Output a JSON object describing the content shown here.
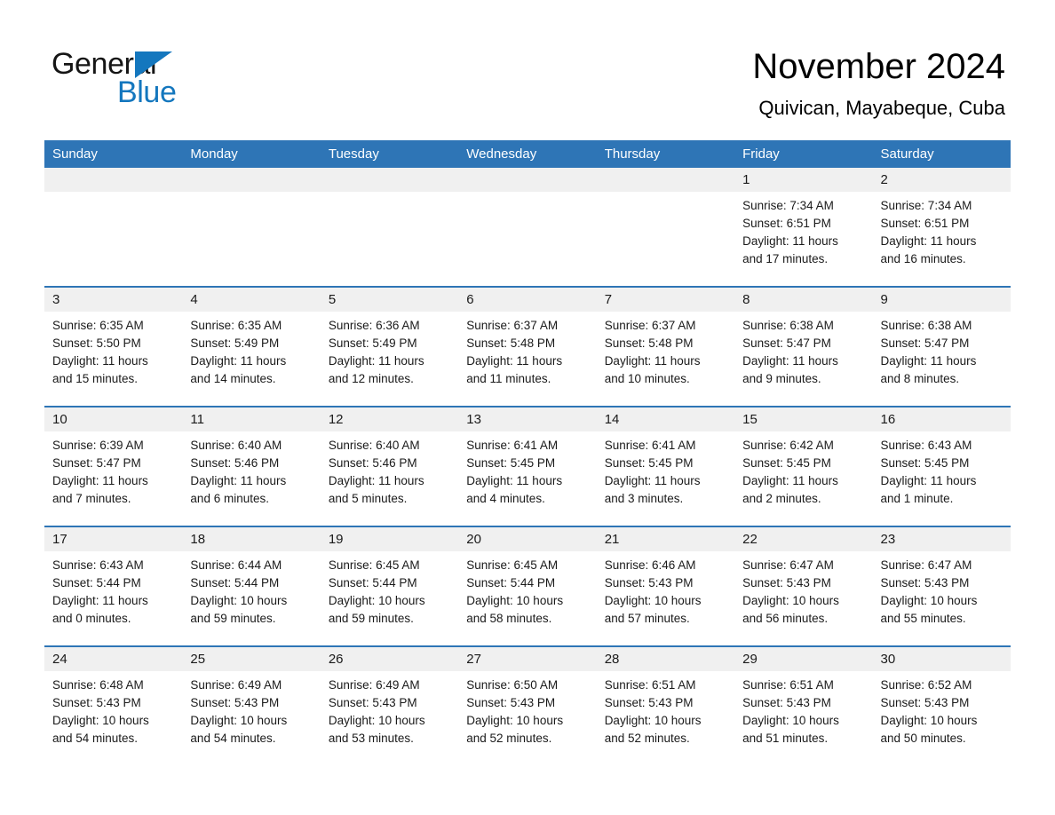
{
  "brand": {
    "line1": "General",
    "line2": "Blue",
    "triangle_color": "#1477be"
  },
  "header": {
    "month_title": "November 2024",
    "location": "Quivican, Mayabeque, Cuba"
  },
  "theme": {
    "header_blue": "#2e75b6",
    "daynum_band": "#f0f0f0",
    "text": "#1a1a1a"
  },
  "weekday_headers": [
    "Sunday",
    "Monday",
    "Tuesday",
    "Wednesday",
    "Thursday",
    "Friday",
    "Saturday"
  ],
  "weeks": [
    [
      {
        "day": "",
        "sunrise": "",
        "sunset": "",
        "daylight1": "",
        "daylight2": ""
      },
      {
        "day": "",
        "sunrise": "",
        "sunset": "",
        "daylight1": "",
        "daylight2": ""
      },
      {
        "day": "",
        "sunrise": "",
        "sunset": "",
        "daylight1": "",
        "daylight2": ""
      },
      {
        "day": "",
        "sunrise": "",
        "sunset": "",
        "daylight1": "",
        "daylight2": ""
      },
      {
        "day": "",
        "sunrise": "",
        "sunset": "",
        "daylight1": "",
        "daylight2": ""
      },
      {
        "day": "1",
        "sunrise": "Sunrise: 7:34 AM",
        "sunset": "Sunset: 6:51 PM",
        "daylight1": "Daylight: 11 hours",
        "daylight2": "and 17 minutes."
      },
      {
        "day": "2",
        "sunrise": "Sunrise: 7:34 AM",
        "sunset": "Sunset: 6:51 PM",
        "daylight1": "Daylight: 11 hours",
        "daylight2": "and 16 minutes."
      }
    ],
    [
      {
        "day": "3",
        "sunrise": "Sunrise: 6:35 AM",
        "sunset": "Sunset: 5:50 PM",
        "daylight1": "Daylight: 11 hours",
        "daylight2": "and 15 minutes."
      },
      {
        "day": "4",
        "sunrise": "Sunrise: 6:35 AM",
        "sunset": "Sunset: 5:49 PM",
        "daylight1": "Daylight: 11 hours",
        "daylight2": "and 14 minutes."
      },
      {
        "day": "5",
        "sunrise": "Sunrise: 6:36 AM",
        "sunset": "Sunset: 5:49 PM",
        "daylight1": "Daylight: 11 hours",
        "daylight2": "and 12 minutes."
      },
      {
        "day": "6",
        "sunrise": "Sunrise: 6:37 AM",
        "sunset": "Sunset: 5:48 PM",
        "daylight1": "Daylight: 11 hours",
        "daylight2": "and 11 minutes."
      },
      {
        "day": "7",
        "sunrise": "Sunrise: 6:37 AM",
        "sunset": "Sunset: 5:48 PM",
        "daylight1": "Daylight: 11 hours",
        "daylight2": "and 10 minutes."
      },
      {
        "day": "8",
        "sunrise": "Sunrise: 6:38 AM",
        "sunset": "Sunset: 5:47 PM",
        "daylight1": "Daylight: 11 hours",
        "daylight2": "and 9 minutes."
      },
      {
        "day": "9",
        "sunrise": "Sunrise: 6:38 AM",
        "sunset": "Sunset: 5:47 PM",
        "daylight1": "Daylight: 11 hours",
        "daylight2": "and 8 minutes."
      }
    ],
    [
      {
        "day": "10",
        "sunrise": "Sunrise: 6:39 AM",
        "sunset": "Sunset: 5:47 PM",
        "daylight1": "Daylight: 11 hours",
        "daylight2": "and 7 minutes."
      },
      {
        "day": "11",
        "sunrise": "Sunrise: 6:40 AM",
        "sunset": "Sunset: 5:46 PM",
        "daylight1": "Daylight: 11 hours",
        "daylight2": "and 6 minutes."
      },
      {
        "day": "12",
        "sunrise": "Sunrise: 6:40 AM",
        "sunset": "Sunset: 5:46 PM",
        "daylight1": "Daylight: 11 hours",
        "daylight2": "and 5 minutes."
      },
      {
        "day": "13",
        "sunrise": "Sunrise: 6:41 AM",
        "sunset": "Sunset: 5:45 PM",
        "daylight1": "Daylight: 11 hours",
        "daylight2": "and 4 minutes."
      },
      {
        "day": "14",
        "sunrise": "Sunrise: 6:41 AM",
        "sunset": "Sunset: 5:45 PM",
        "daylight1": "Daylight: 11 hours",
        "daylight2": "and 3 minutes."
      },
      {
        "day": "15",
        "sunrise": "Sunrise: 6:42 AM",
        "sunset": "Sunset: 5:45 PM",
        "daylight1": "Daylight: 11 hours",
        "daylight2": "and 2 minutes."
      },
      {
        "day": "16",
        "sunrise": "Sunrise: 6:43 AM",
        "sunset": "Sunset: 5:45 PM",
        "daylight1": "Daylight: 11 hours",
        "daylight2": "and 1 minute."
      }
    ],
    [
      {
        "day": "17",
        "sunrise": "Sunrise: 6:43 AM",
        "sunset": "Sunset: 5:44 PM",
        "daylight1": "Daylight: 11 hours",
        "daylight2": "and 0 minutes."
      },
      {
        "day": "18",
        "sunrise": "Sunrise: 6:44 AM",
        "sunset": "Sunset: 5:44 PM",
        "daylight1": "Daylight: 10 hours",
        "daylight2": "and 59 minutes."
      },
      {
        "day": "19",
        "sunrise": "Sunrise: 6:45 AM",
        "sunset": "Sunset: 5:44 PM",
        "daylight1": "Daylight: 10 hours",
        "daylight2": "and 59 minutes."
      },
      {
        "day": "20",
        "sunrise": "Sunrise: 6:45 AM",
        "sunset": "Sunset: 5:44 PM",
        "daylight1": "Daylight: 10 hours",
        "daylight2": "and 58 minutes."
      },
      {
        "day": "21",
        "sunrise": "Sunrise: 6:46 AM",
        "sunset": "Sunset: 5:43 PM",
        "daylight1": "Daylight: 10 hours",
        "daylight2": "and 57 minutes."
      },
      {
        "day": "22",
        "sunrise": "Sunrise: 6:47 AM",
        "sunset": "Sunset: 5:43 PM",
        "daylight1": "Daylight: 10 hours",
        "daylight2": "and 56 minutes."
      },
      {
        "day": "23",
        "sunrise": "Sunrise: 6:47 AM",
        "sunset": "Sunset: 5:43 PM",
        "daylight1": "Daylight: 10 hours",
        "daylight2": "and 55 minutes."
      }
    ],
    [
      {
        "day": "24",
        "sunrise": "Sunrise: 6:48 AM",
        "sunset": "Sunset: 5:43 PM",
        "daylight1": "Daylight: 10 hours",
        "daylight2": "and 54 minutes."
      },
      {
        "day": "25",
        "sunrise": "Sunrise: 6:49 AM",
        "sunset": "Sunset: 5:43 PM",
        "daylight1": "Daylight: 10 hours",
        "daylight2": "and 54 minutes."
      },
      {
        "day": "26",
        "sunrise": "Sunrise: 6:49 AM",
        "sunset": "Sunset: 5:43 PM",
        "daylight1": "Daylight: 10 hours",
        "daylight2": "and 53 minutes."
      },
      {
        "day": "27",
        "sunrise": "Sunrise: 6:50 AM",
        "sunset": "Sunset: 5:43 PM",
        "daylight1": "Daylight: 10 hours",
        "daylight2": "and 52 minutes."
      },
      {
        "day": "28",
        "sunrise": "Sunrise: 6:51 AM",
        "sunset": "Sunset: 5:43 PM",
        "daylight1": "Daylight: 10 hours",
        "daylight2": "and 52 minutes."
      },
      {
        "day": "29",
        "sunrise": "Sunrise: 6:51 AM",
        "sunset": "Sunset: 5:43 PM",
        "daylight1": "Daylight: 10 hours",
        "daylight2": "and 51 minutes."
      },
      {
        "day": "30",
        "sunrise": "Sunrise: 6:52 AM",
        "sunset": "Sunset: 5:43 PM",
        "daylight1": "Daylight: 10 hours",
        "daylight2": "and 50 minutes."
      }
    ]
  ]
}
